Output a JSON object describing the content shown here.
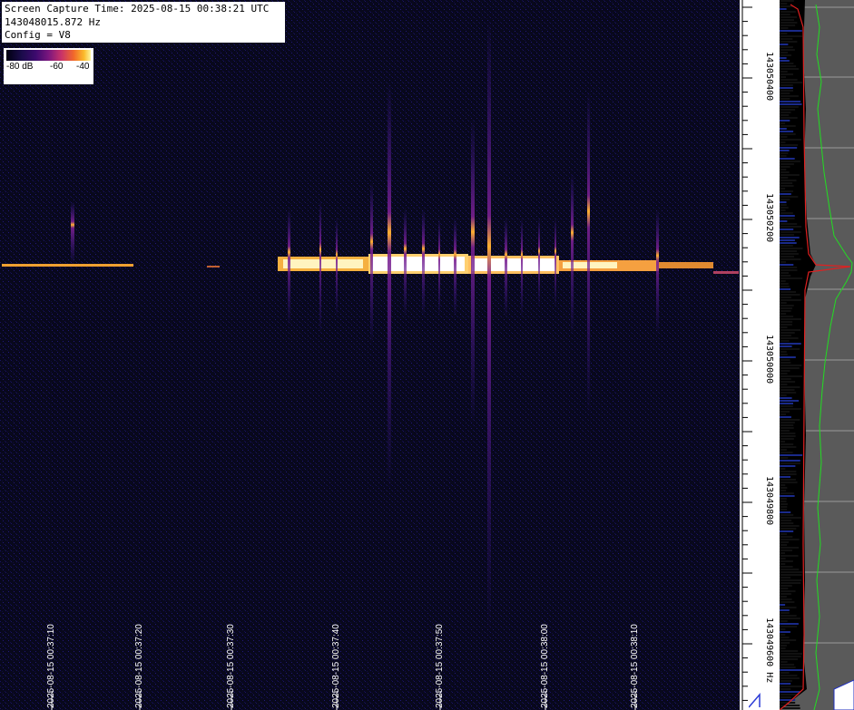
{
  "info": {
    "capture_time": "Screen Capture Time: 2025-08-15 00:38:21 UTC",
    "frequency": "143048015.872 Hz",
    "config": "Config = V8"
  },
  "colorbar": {
    "labels": [
      "-80 dB",
      "-60",
      "-40"
    ]
  },
  "time_axis": {
    "labels": [
      "2025-08-15 00:37:10",
      "2025-08-15 00:37:20",
      "2025-08-15 00:37:30",
      "2025-08-15 00:37:40",
      "2025-08-15 00:37:50",
      "2025-08-15 00:38:00",
      "2025-08-15 00:38:10"
    ]
  },
  "freq_axis": {
    "labels": [
      "143050400",
      "143050200",
      "143050000",
      "143049800",
      "143049600 Hz"
    ]
  },
  "colors": {
    "background": "#0a0a1a",
    "spectrum_bg": "#5a5a5a",
    "trace_green": "#22dd22",
    "trace_red": "#e02020",
    "signal_hot": "#fffbe0"
  }
}
